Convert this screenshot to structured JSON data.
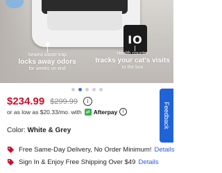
{
  "hero": {
    "panel_label": "IO",
    "callout_left": {
      "small_top": "Sealed waste trap",
      "big": "locks away odors",
      "small_bottom": "for weeks on end"
    },
    "callout_right": {
      "small_top": "Health counter",
      "big": "tracks your cat's visits",
      "small_bottom": "to the box"
    }
  },
  "carousel": {
    "count": 5,
    "active_index": 1
  },
  "price": {
    "current": "$234.99",
    "original": "$299.99",
    "info_glyph": "i"
  },
  "afterpay": {
    "prefix": "or as low as $20.33/mo. with",
    "badge_glyph": "⇄",
    "brand": "Afterpay",
    "info_glyph": "i"
  },
  "color": {
    "label": "Color:",
    "value": "White & Grey"
  },
  "shipping": [
    {
      "text": "Free Same-Day Delivery, No Order Minimum!",
      "link": "Details",
      "icon": "tag-icon"
    },
    {
      "text": "Sign In & Enjoy Free Shipping Over $49",
      "link": "Details",
      "icon": "tag-icon"
    }
  ],
  "feedback_tab": {
    "label": "Feedback"
  },
  "colors": {
    "price_red": "#c8102e",
    "link_blue": "#2a5bd7",
    "feedback_blue": "#1f63d6",
    "afterpay_green": "#2fb44a"
  }
}
